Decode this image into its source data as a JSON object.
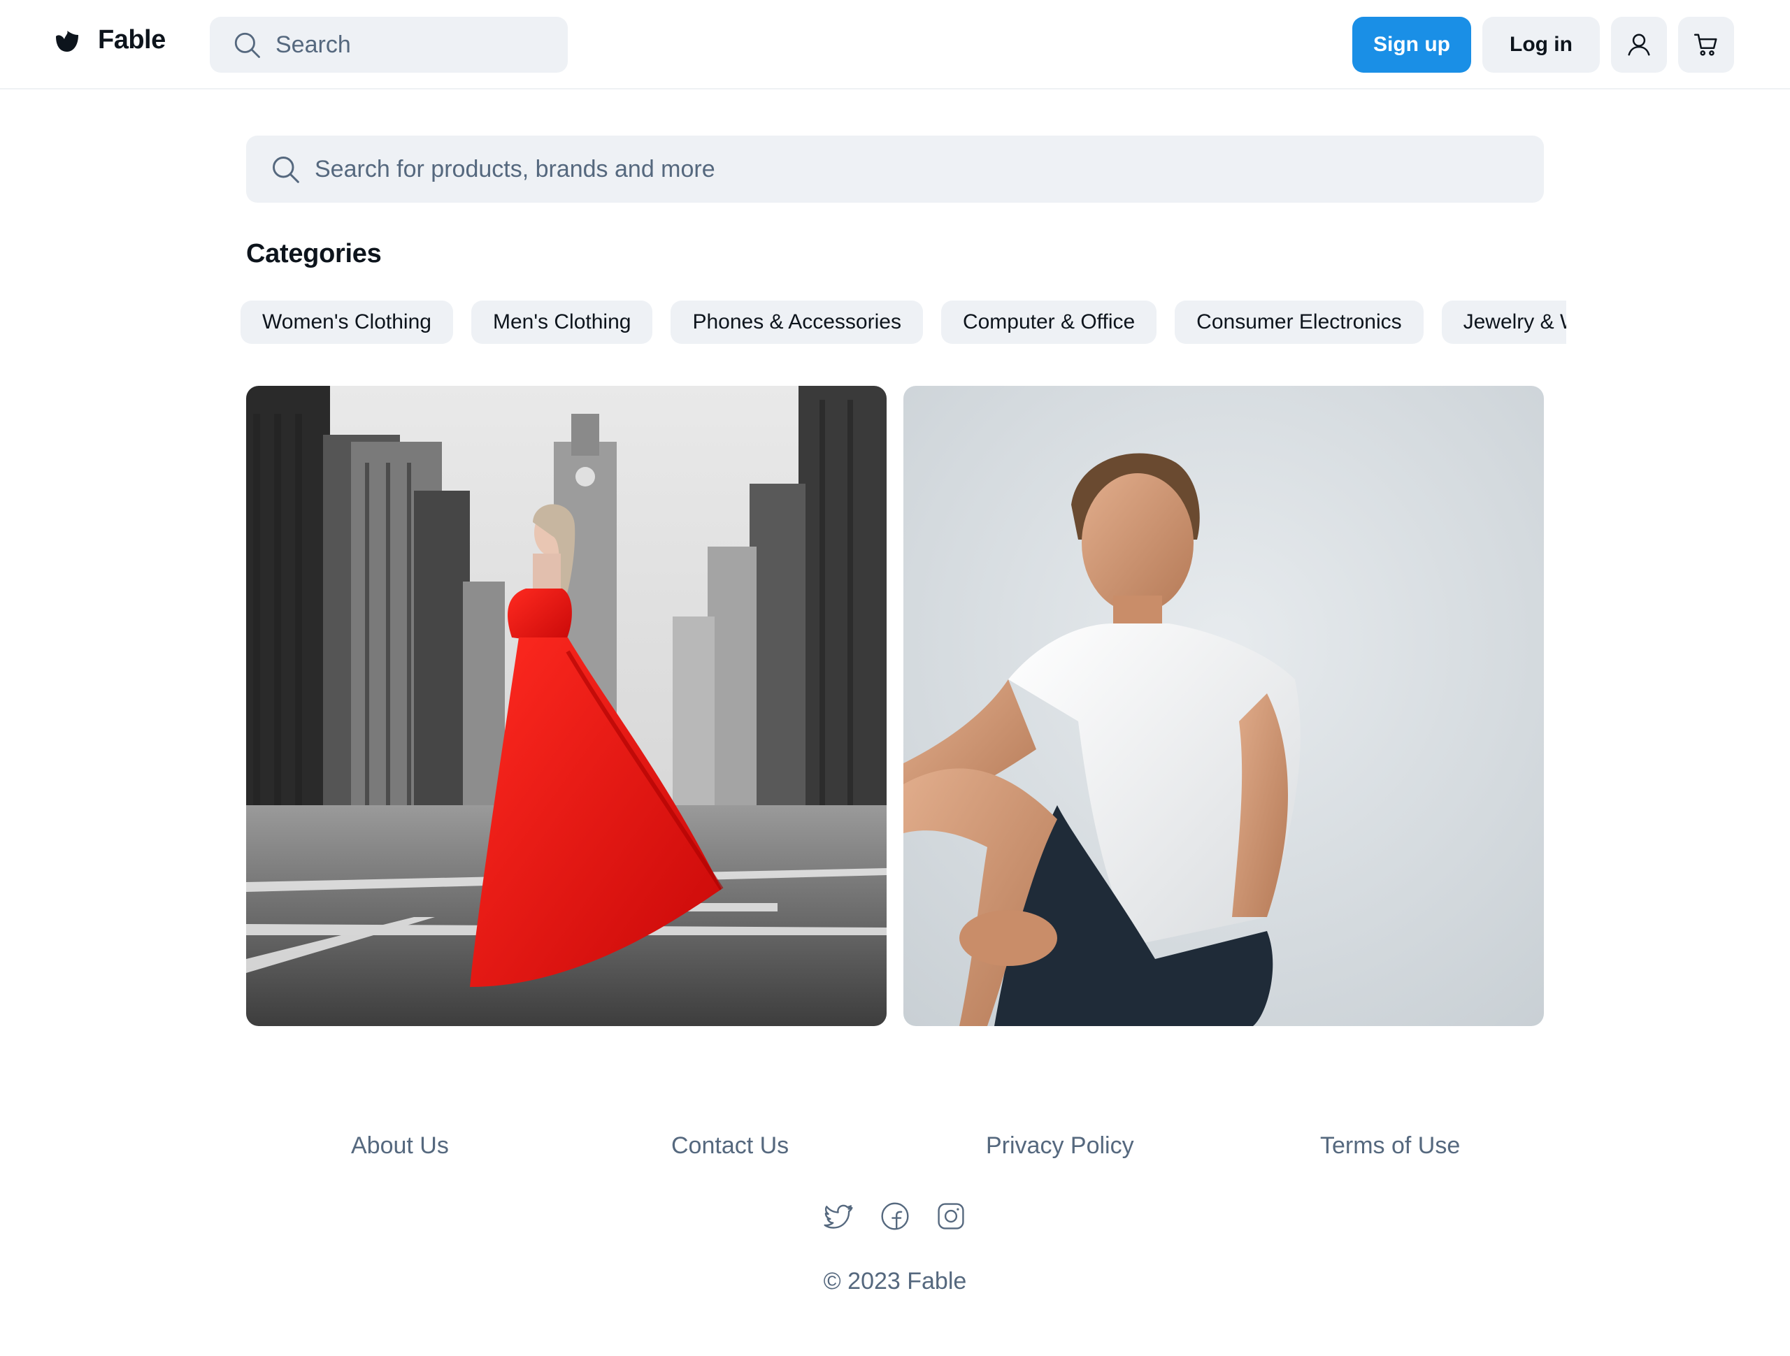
{
  "brand": {
    "name": "Fable"
  },
  "header": {
    "search_placeholder": "Search",
    "signup_label": "Sign up",
    "login_label": "Log in",
    "user_icon": "user-icon",
    "cart_icon": "cart-icon"
  },
  "main": {
    "search_placeholder": "Search for products, brands and more",
    "categories_title": "Categories",
    "categories": [
      "Women's Clothing",
      "Men's Clothing",
      "Phones & Accessories",
      "Computer & Office",
      "Consumer Electronics",
      "Jewelry & Watches"
    ],
    "features": [
      {
        "subject": "woman in red dress on city street"
      },
      {
        "subject": "man in white t-shirt"
      }
    ]
  },
  "footer": {
    "links": [
      "About Us",
      "Contact Us",
      "Privacy Policy",
      "Terms of Use"
    ],
    "social_icons": [
      "twitter-icon",
      "facebook-icon",
      "instagram-icon"
    ],
    "copyright": "© 2023 Fable"
  },
  "colors": {
    "accent": "#1a8fe6",
    "surface": "#eef1f5",
    "muted_text": "#55687e",
    "text": "#0d141c"
  }
}
